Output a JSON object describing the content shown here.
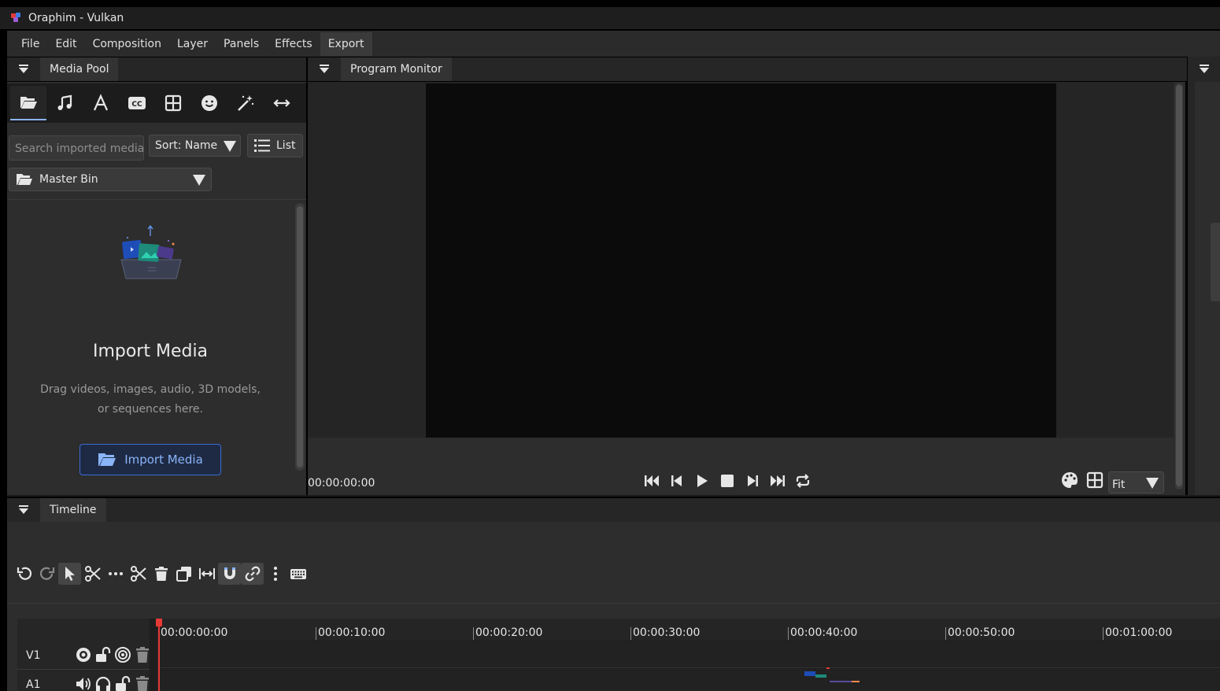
{
  "window": {
    "title": "Oraphim - Vulkan"
  },
  "menu": {
    "items": [
      {
        "label": "File"
      },
      {
        "label": "Edit"
      },
      {
        "label": "Composition"
      },
      {
        "label": "Layer"
      },
      {
        "label": "Panels"
      },
      {
        "label": "Effects"
      },
      {
        "label": "Export"
      }
    ]
  },
  "media_pool": {
    "tab_label": "Media Pool",
    "tools": [
      "folder-open-icon",
      "music-icon",
      "text-icon",
      "captions-icon",
      "grid-icon",
      "emoji-icon",
      "magic-wand-icon",
      "transition-icon"
    ],
    "search": {
      "placeholder": "Search imported media"
    },
    "sort": {
      "value": "Sort: Name"
    },
    "view": {
      "label": "List"
    },
    "bin": {
      "value": "Master Bin"
    },
    "empty": {
      "title": "Import Media",
      "description": "Drag videos, images, audio, 3D models, or sequences here.",
      "button_label": "Import Media"
    }
  },
  "program_monitor": {
    "tab_label": "Program Monitor",
    "timecode": "00:00:00:00",
    "zoom": {
      "value": "Fit"
    }
  },
  "timeline": {
    "tab_label": "Timeline",
    "ruler": [
      "00:00:00:00",
      "00:00:10:00",
      "00:00:20:00",
      "00:00:30:00",
      "00:00:40:00",
      "00:00:50:00",
      "00:01:00:00"
    ],
    "tracks": [
      {
        "label": "V1",
        "type": "video"
      },
      {
        "label": "A1",
        "type": "audio"
      }
    ]
  },
  "colors": {
    "accent": "#8ab4f8",
    "playhead": "#e53935",
    "panel_bg": "#2d2d2d"
  }
}
